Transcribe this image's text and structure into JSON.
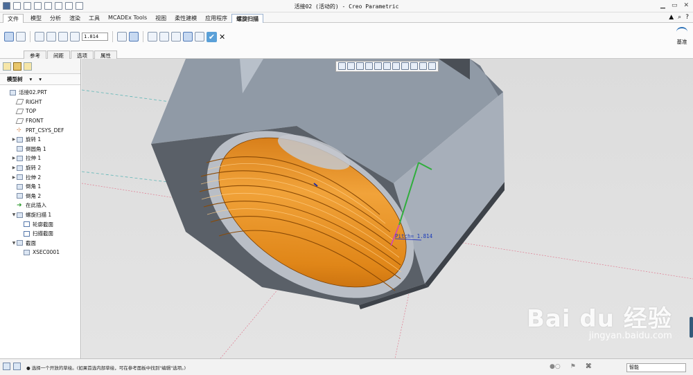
{
  "window": {
    "title": "活接02 (活动的) - Creo Parametric"
  },
  "ribbon_tabs": [
    {
      "label": "文件",
      "file": true
    },
    {
      "label": "模型"
    },
    {
      "label": "分析"
    },
    {
      "label": "渲染"
    },
    {
      "label": "工具"
    },
    {
      "label": "MCADEx Tools"
    },
    {
      "label": "视图"
    },
    {
      "label": "柔性建模"
    },
    {
      "label": "应用程序"
    },
    {
      "label": "螺旋扫描",
      "active": true
    }
  ],
  "ribbon": {
    "pitch_value": "1.814",
    "subtabs": [
      "参考",
      "间距",
      "选项",
      "属性"
    ],
    "datum_label": "基准"
  },
  "model_tree": {
    "header": "模型树",
    "items": [
      {
        "label": "活接02.PRT",
        "icon": "part-icon",
        "level": 0,
        "expand": ""
      },
      {
        "label": "RIGHT",
        "icon": "datum-plane-icon",
        "level": 1,
        "expand": ""
      },
      {
        "label": "TOP",
        "icon": "datum-plane-icon",
        "level": 1,
        "expand": ""
      },
      {
        "label": "FRONT",
        "icon": "datum-plane-icon",
        "level": 1,
        "expand": ""
      },
      {
        "label": "PRT_CSYS_DEF",
        "icon": "csys-icon",
        "level": 1,
        "expand": ""
      },
      {
        "label": "旋转 1",
        "icon": "revolve-icon",
        "level": 1,
        "expand": "▶"
      },
      {
        "label": "倒圆角 1",
        "icon": "round-icon",
        "level": 1,
        "expand": ""
      },
      {
        "label": "拉伸 1",
        "icon": "extrude-icon",
        "level": 1,
        "expand": "▶"
      },
      {
        "label": "旋转 2",
        "icon": "revolve-icon",
        "level": 1,
        "expand": "▶"
      },
      {
        "label": "拉伸 2",
        "icon": "extrude-icon",
        "level": 1,
        "expand": "▶"
      },
      {
        "label": "倒角 1",
        "icon": "chamfer-icon",
        "level": 1,
        "expand": ""
      },
      {
        "label": "倒角 2",
        "icon": "chamfer-icon",
        "level": 1,
        "expand": ""
      },
      {
        "label": "在此插入",
        "icon": "insert-here-icon",
        "level": 1,
        "expand": ""
      },
      {
        "label": "螺旋扫描 1",
        "icon": "helical-sweep-icon",
        "level": 1,
        "expand": "▼"
      },
      {
        "label": "轮廓截面",
        "icon": "sketch-icon",
        "level": 2,
        "expand": ""
      },
      {
        "label": "扫描截面",
        "icon": "sketch-icon",
        "level": 2,
        "expand": ""
      },
      {
        "label": "截面",
        "icon": "section-folder-icon",
        "level": 1,
        "expand": "▼"
      },
      {
        "label": "XSEC0001",
        "icon": "xsec-icon",
        "level": 2,
        "expand": ""
      }
    ]
  },
  "graphics": {
    "pitch_annotation": "Pitch= 1.814"
  },
  "watermark": {
    "brand": "Bai du 经验",
    "url": "jingyan.baidu.com"
  },
  "status": {
    "message": "● 选择一个开放的草绘。(如果首选内部草绘，可在参考面板中找到\"编辑\"选项。)",
    "filter": "智能"
  },
  "colors": {
    "accent": "#2e73b8",
    "thread": "#e8921c",
    "nut_face": "#8f9aa8"
  }
}
